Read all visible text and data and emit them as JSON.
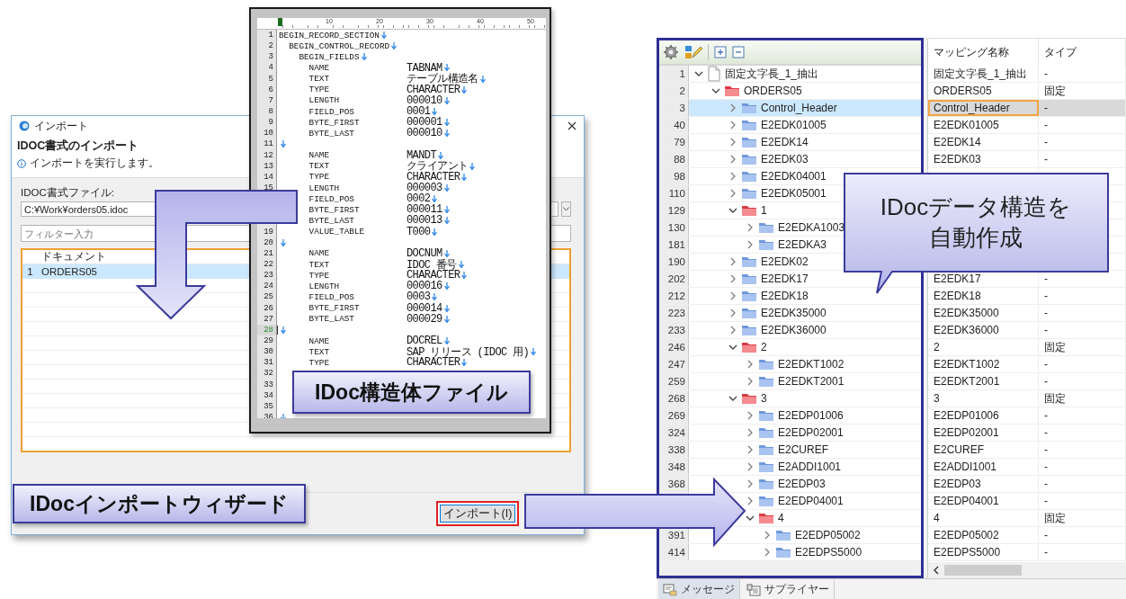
{
  "import_dialog": {
    "title": "インポート",
    "heading": "IDOC書式のインポート",
    "info": "インポートを実行します。",
    "file_label": "IDOC書式ファイル:",
    "file_value": "C:¥Work¥orders05.idoc",
    "filter": {
      "placeholder": "フィルター入力"
    },
    "table": {
      "columns": [
        "ドキュメント"
      ],
      "rows": [
        {
          "number": "1",
          "name": "ORDERS05",
          "selected": true
        }
      ]
    },
    "buttons": [
      {
        "label": "インポート(I)",
        "highlighted": true
      }
    ]
  },
  "dialog_caption": "IDocインポートウィザード",
  "structure_file": {
    "ruler": [
      "10",
      "20",
      "30",
      "40",
      "50"
    ],
    "lines": [
      {
        "no": "1",
        "text": "BEGIN_RECORD_SECTION",
        "eol": true,
        "current": false
      },
      {
        "no": "2",
        "text": "  BEGIN_CONTROL_RECORD",
        "eol": true,
        "current": false
      },
      {
        "no": "3",
        "text": "    BEGIN_FIELDS",
        "eol": true,
        "current": false
      },
      {
        "no": "4",
        "text": "      NAME",
        "value": "TABNAM",
        "eol": true,
        "current": false
      },
      {
        "no": "5",
        "text": "      TEXT",
        "value": "テーブル構造名",
        "eol": true,
        "current": false
      },
      {
        "no": "6",
        "text": "      TYPE",
        "value": "CHARACTER",
        "eol": true,
        "current": false
      },
      {
        "no": "7",
        "text": "      LENGTH",
        "value": "000010",
        "eol": true,
        "current": false
      },
      {
        "no": "8",
        "text": "      FIELD_POS",
        "value": "0001",
        "eol": true,
        "current": false
      },
      {
        "no": "9",
        "text": "      BYTE_FIRST",
        "value": "000001",
        "eol": true,
        "current": false
      },
      {
        "no": "10",
        "text": "      BYTE_LAST",
        "value": "000010",
        "eol": true,
        "current": false
      },
      {
        "no": "11",
        "eol": true,
        "current": false
      },
      {
        "no": "12",
        "text": "      NAME",
        "value": "MANDT",
        "eol": true,
        "current": false
      },
      {
        "no": "13",
        "text": "      TEXT",
        "value": "クライアント",
        "eol": true,
        "current": false
      },
      {
        "no": "14",
        "text": "      TYPE",
        "value": "CHARACTER",
        "eol": true,
        "current": false
      },
      {
        "no": "15",
        "text": "      LENGTH",
        "value": "000003",
        "eol": true,
        "current": false
      },
      {
        "text": "      FIELD_POS",
        "value": "0002",
        "eol": true,
        "current": false
      },
      {
        "text": "      BYTE_FIRST",
        "value": "000011",
        "eol": true,
        "current": false
      },
      {
        "text": "      BYTE_LAST",
        "value": "000013",
        "eol": true,
        "current": false
      },
      {
        "no": "19",
        "text": "      VALUE_TABLE",
        "value": "T000",
        "eol": true,
        "current": false
      },
      {
        "no": "20",
        "eol": true,
        "current": false
      },
      {
        "no": "21",
        "text": "      NAME",
        "value": "DOCNUM",
        "eol": true,
        "current": false
      },
      {
        "no": "22",
        "text": "      TEXT",
        "value": "IDOC 番号",
        "eol": true,
        "current": false
      },
      {
        "no": "23",
        "text": "      TYPE",
        "value": "CHARACTER",
        "eol": true,
        "current": false
      },
      {
        "no": "24",
        "text": "      LENGTH",
        "value": "000016",
        "eol": true,
        "current": false
      },
      {
        "no": "25",
        "text": "      FIELD_POS",
        "value": "0003",
        "eol": true,
        "current": false
      },
      {
        "no": "26",
        "text": "      BYTE_FIRST",
        "value": "000014",
        "eol": true,
        "current": false
      },
      {
        "no": "27",
        "text": "      BYTE_LAST",
        "value": "000029",
        "eol": true,
        "current": false
      },
      {
        "no": "28",
        "eol": true,
        "current": true
      },
      {
        "no": "29",
        "text": "      NAME",
        "value": "DOCREL",
        "eol": true,
        "current": false
      },
      {
        "no": "30",
        "text": "      TEXT",
        "value": "SAP リリース (IDOC 用)",
        "eol": true,
        "current": false
      },
      {
        "no": "31",
        "text": "      TYPE",
        "value": "CHARACTER",
        "eol": true,
        "current": false
      },
      {
        "no": "32",
        "eol": false,
        "current": false
      },
      {
        "no": "33",
        "eol": false,
        "current": false
      },
      {
        "no": "34",
        "eol": false,
        "current": false
      },
      {
        "no": "35",
        "eol": false,
        "current": false
      },
      {
        "no": "36",
        "eol": true,
        "current": false
      }
    ]
  },
  "file_caption": "IDoc構造体ファイル",
  "mapping_app": {
    "columns": [
      "マッピング名称",
      "タイプ"
    ],
    "tree": [
      {
        "line": "1",
        "label": "固定文字長_1_抽出",
        "kind": "document",
        "expanded": true,
        "selected": false,
        "mapping": "固定文字長_1_抽出",
        "type": "-",
        "children": [
          {
            "line": "2",
            "label": "ORDERS05",
            "kind": "segment-group",
            "expanded": true,
            "selected": false,
            "mapping": "ORDERS05",
            "type": "固定",
            "children": [
              {
                "line": "3",
                "label": "Control_Header",
                "kind": "segment",
                "expanded": false,
                "selected": true,
                "mapping": "Control_Header",
                "type": "-"
              },
              {
                "line": "40",
                "label": "E2EDK01005",
                "kind": "segment",
                "expanded": false,
                "selected": false,
                "mapping": "E2EDK01005",
                "type": "-"
              },
              {
                "line": "79",
                "label": "E2EDK14",
                "kind": "segment",
                "expanded": false,
                "selected": false,
                "mapping": "E2EDK14",
                "type": "-"
              },
              {
                "line": "88",
                "label": "E2EDK03",
                "kind": "segment",
                "expanded": false,
                "selected": false,
                "mapping": "E2EDK03",
                "type": "-"
              },
              {
                "line": "98",
                "label": "E2EDK04001",
                "kind": "segment",
                "expanded": false,
                "selected": false
              },
              {
                "line": "110",
                "label": "E2EDK05001",
                "kind": "segment",
                "expanded": false,
                "selected": false
              },
              {
                "line": "129",
                "label": "1",
                "kind": "segment-group",
                "expanded": true,
                "selected": false,
                "children": [
                  {
                    "line": "130",
                    "label": "E2EDKA1003",
                    "kind": "segment",
                    "expanded": false,
                    "selected": false
                  },
                  {
                    "line": "181",
                    "label": "E2EDKA3",
                    "kind": "segment",
                    "expanded": false,
                    "selected": false
                  }
                ]
              },
              {
                "line": "190",
                "label": "E2EDK02",
                "kind": "segment",
                "expanded": false,
                "selected": false
              },
              {
                "line": "202",
                "label": "E2EDK17",
                "kind": "segment",
                "expanded": false,
                "selected": false,
                "mapping": "E2EDK17",
                "type": "-"
              },
              {
                "line": "212",
                "label": "E2EDK18",
                "kind": "segment",
                "expanded": false,
                "selected": false,
                "mapping": "E2EDK18",
                "type": "-"
              },
              {
                "line": "223",
                "label": "E2EDK35000",
                "kind": "segment",
                "expanded": false,
                "selected": false,
                "mapping": "E2EDK35000",
                "type": "-"
              },
              {
                "line": "233",
                "label": "E2EDK36000",
                "kind": "segment",
                "expanded": false,
                "selected": false,
                "mapping": "E2EDK36000",
                "type": "-"
              },
              {
                "line": "246",
                "label": "2",
                "kind": "segment-group",
                "expanded": true,
                "selected": false,
                "mapping": "2",
                "type": "固定",
                "children": [
                  {
                    "line": "247",
                    "label": "E2EDKT1002",
                    "kind": "segment",
                    "expanded": false,
                    "selected": false,
                    "mapping": "E2EDKT1002",
                    "type": "-"
                  },
                  {
                    "line": "259",
                    "label": "E2EDKT2001",
                    "kind": "segment",
                    "expanded": false,
                    "selected": false,
                    "mapping": "E2EDKT2001",
                    "type": "-"
                  }
                ]
              },
              {
                "line": "268",
                "label": "3",
                "kind": "segment-group",
                "expanded": true,
                "selected": false,
                "mapping": "3",
                "type": "固定",
                "children": [
                  {
                    "line": "269",
                    "label": "E2EDP01006",
                    "kind": "segment",
                    "expanded": false,
                    "selected": false,
                    "mapping": "E2EDP01006",
                    "type": "-"
                  },
                  {
                    "line": "324",
                    "label": "E2EDP02001",
                    "kind": "segment",
                    "expanded": false,
                    "selected": false,
                    "mapping": "E2EDP02001",
                    "type": "-"
                  },
                  {
                    "line": "338",
                    "label": "E2CUREF",
                    "kind": "segment",
                    "expanded": false,
                    "selected": false,
                    "mapping": "E2CUREF",
                    "type": "-"
                  },
                  {
                    "line": "348",
                    "label": "E2ADDI1001",
                    "kind": "segment",
                    "expanded": false,
                    "selected": false,
                    "mapping": "E2ADDI1001",
                    "type": "-"
                  },
                  {
                    "line": "368",
                    "label": "E2EDP03",
                    "kind": "segment",
                    "expanded": false,
                    "selected": false,
                    "mapping": "E2EDP03",
                    "type": "-"
                  },
                  {
                    "label": "E2EDP04001",
                    "kind": "segment",
                    "expanded": false,
                    "selected": false,
                    "mapping": "E2EDP04001",
                    "type": "-"
                  },
                  {
                    "label": "4",
                    "kind": "segment-group",
                    "expanded": true,
                    "selected": false,
                    "mapping": "4",
                    "type": "固定",
                    "children": [
                      {
                        "line": "391",
                        "label": "E2EDP05002",
                        "kind": "segment",
                        "expanded": false,
                        "selected": false,
                        "mapping": "E2EDP05002",
                        "type": "-"
                      },
                      {
                        "line": "414",
                        "label": "E2EDPS5000",
                        "kind": "segment",
                        "expanded": false,
                        "selected": false,
                        "mapping": "E2EDPS5000",
                        "type": "-"
                      }
                    ]
                  }
                ]
              }
            ]
          }
        ]
      }
    ],
    "tabs": [
      {
        "label": "メッセージ",
        "selected": true
      },
      {
        "label": "サプライヤー",
        "selected": false
      }
    ]
  },
  "app_callout": [
    "IDocデータ構造を",
    "自動作成"
  ]
}
